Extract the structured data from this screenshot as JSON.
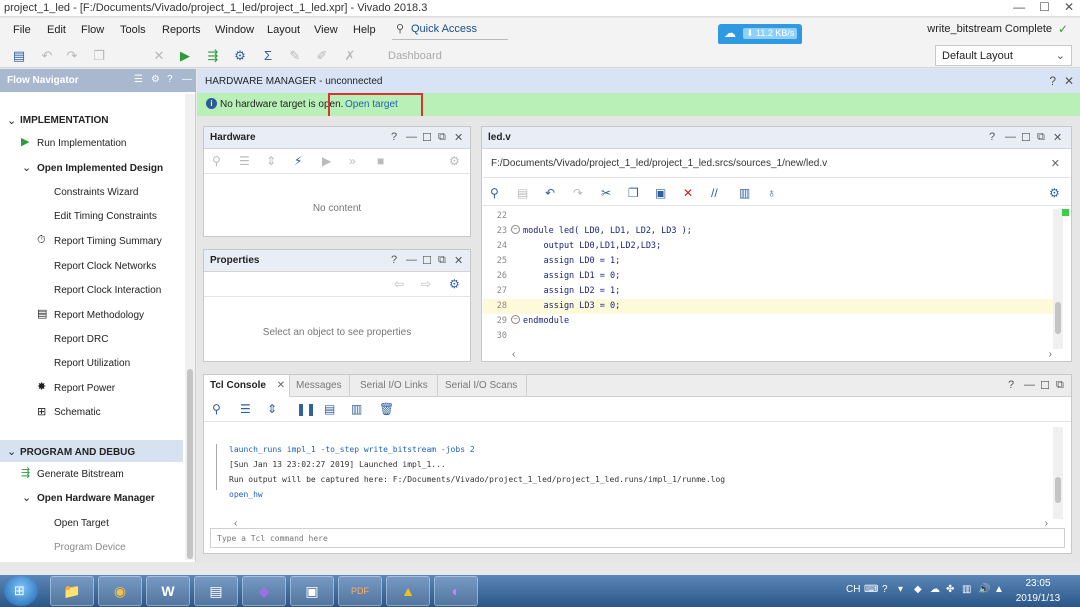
{
  "window": {
    "title": "project_1_led - [F:/Documents/Vivado/project_1_led/project_1_led.xpr] - Vivado 2018.3",
    "minimize": "—",
    "maximize": "☐",
    "close": "✕"
  },
  "menu": [
    "File",
    "Edit",
    "Flow",
    "Tools",
    "Reports",
    "Window",
    "Layout",
    "View",
    "Help"
  ],
  "quick_access": {
    "placeholder": "Quick Access"
  },
  "net_badge": {
    "speed": "⬇ 11.2 KB/s"
  },
  "status": {
    "text": "write_bitstream Complete",
    "check": "✓"
  },
  "toolbar": {
    "dashboard": "Dashboard"
  },
  "layout_select": {
    "value": "Default Layout"
  },
  "flow_navigator": {
    "title": "Flow Navigator",
    "implementation": {
      "heading": "IMPLEMENTATION",
      "items": {
        "run_impl": "Run Implementation",
        "open_impl": "Open Implemented Design",
        "constraints_wizard": "Constraints Wizard",
        "edit_timing": "Edit Timing Constraints",
        "report_timing": "Report Timing Summary",
        "report_clock_networks": "Report Clock Networks",
        "report_clock_interaction": "Report Clock Interaction",
        "report_methodology": "Report Methodology",
        "report_drc": "Report DRC",
        "report_utilization": "Report Utilization",
        "report_power": "Report Power",
        "schematic": "Schematic"
      }
    },
    "program_debug": {
      "heading": "PROGRAM AND DEBUG",
      "items": {
        "gen_bitstream": "Generate Bitstream",
        "open_hw_mgr": "Open Hardware Manager",
        "open_target": "Open Target",
        "program_device": "Program Device"
      }
    }
  },
  "hw_manager": {
    "title": "HARDWARE MANAGER - unconnected",
    "banner_text": "No hardware target is open.",
    "banner_link": "Open target"
  },
  "hardware_panel": {
    "title": "Hardware",
    "empty": "No content"
  },
  "properties_panel": {
    "title": "Properties",
    "empty": "Select an object to see properties"
  },
  "editor": {
    "tab": "led.v",
    "path": "F:/Documents/Vivado/project_1_led/project_1_led.srcs/sources_1/new/led.v",
    "lines": [
      {
        "n": "22",
        "code": ""
      },
      {
        "n": "23",
        "code": "module led( LD0, LD1, LD2, LD3 );"
      },
      {
        "n": "24",
        "code": "    output LD0,LD1,LD2,LD3;"
      },
      {
        "n": "25",
        "code": "    assign LD0 = 1;"
      },
      {
        "n": "26",
        "code": "    assign LD1 = 0;"
      },
      {
        "n": "27",
        "code": "    assign LD2 = 1;"
      },
      {
        "n": "28",
        "code": "    assign LD3 = 0;"
      },
      {
        "n": "29",
        "code": "endmodule"
      },
      {
        "n": "30",
        "code": ""
      }
    ]
  },
  "console": {
    "tabs": [
      "Tcl Console",
      "Messages",
      "Serial I/O Links",
      "Serial I/O Scans"
    ],
    "lines": [
      "launch_runs impl_1 -to_step write_bitstream -jobs 2",
      "[Sun Jan 13 23:02:27 2019] Launched impl_1...",
      "Run output will be captured here: F:/Documents/Vivado/project_1_led/project_1_led.runs/impl_1/runme.log",
      "open_hw"
    ],
    "input_placeholder": "Type a Tcl command here"
  },
  "taskbar": {
    "apps": [
      "📁",
      "◉",
      "W",
      "▤",
      "◆",
      "▣",
      "PDF",
      "▲",
      "◐"
    ],
    "tray_lang": "CH",
    "time": "23:05",
    "date": "2019/1/13"
  },
  "colors": {
    "banner_bg": "#b9f0b8",
    "accent_link": "#1d62b8",
    "highlight_box": "#d9342b",
    "nav_header": "#a8b8cf"
  }
}
